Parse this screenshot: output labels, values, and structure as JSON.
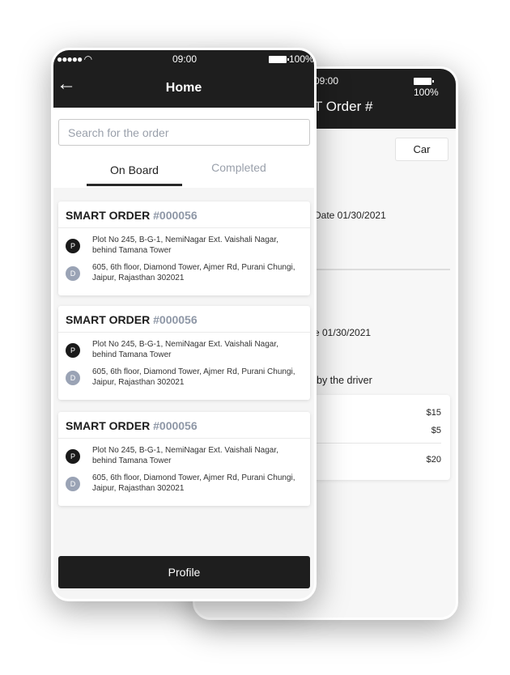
{
  "back_screen": {
    "status_time": "09:00",
    "status_battery": "100%",
    "title": "T Order #",
    "car_button": "Car",
    "date1": "Date 01/30/2021",
    "date2": "e 01/30/2021",
    "driver_text": "by the driver",
    "prices": [
      "$15",
      "$5"
    ],
    "total": "$20"
  },
  "front_screen": {
    "status_time": "09:00",
    "status_battery": "100%",
    "title": "Home",
    "search_placeholder": "Search for the order",
    "tabs": [
      {
        "label": "On Board",
        "active": true
      },
      {
        "label": "Completed",
        "active": false
      }
    ],
    "orders": [
      {
        "title": "SMART ORDER",
        "number": "#000056",
        "pickup_badge": "P",
        "pickup": "Plot No 245, B-G-1, NemiNagar Ext. Vaishali Nagar, behind Tamana Tower",
        "drop_badge": "D",
        "drop": "605, 6th floor, Diamond Tower, Ajmer Rd, Purani Chungi, Jaipur, Rajasthan 302021"
      },
      {
        "title": "SMART ORDER",
        "number": "#000056",
        "pickup_badge": "P",
        "pickup": "Plot No 245, B-G-1, NemiNagar Ext. Vaishali Nagar, behind Tamana Tower",
        "drop_badge": "D",
        "drop": "605, 6th floor, Diamond Tower, Ajmer Rd, Purani Chungi, Jaipur, Rajasthan 302021"
      },
      {
        "title": "SMART ORDER",
        "number": "#000056",
        "pickup_badge": "P",
        "pickup": "Plot No 245, B-G-1, NemiNagar Ext. Vaishali Nagar, behind Tamana Tower",
        "drop_badge": "D",
        "drop": "605, 6th floor, Diamond Tower, Ajmer Rd, Purani Chungi, Jaipur, Rajasthan 302021"
      }
    ],
    "profile_button": "Profile"
  },
  "colors": {
    "header": "#1e1e1e",
    "pickup": "#1a1a1a",
    "drop": "#9aa3b5",
    "order_number": "#8e97a6"
  }
}
